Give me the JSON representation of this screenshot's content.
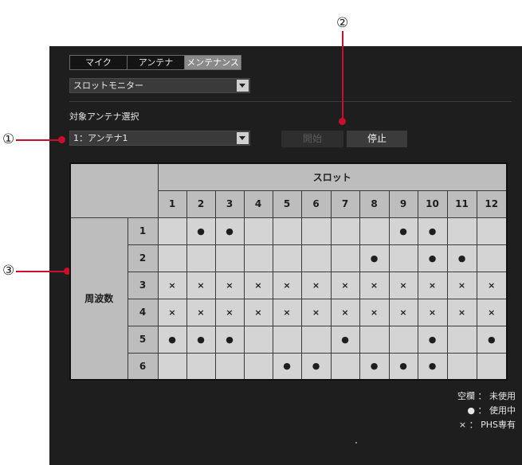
{
  "tabs": [
    {
      "label": "マイク",
      "active": false
    },
    {
      "label": "アンテナ",
      "active": false
    },
    {
      "label": "メンテナンス",
      "active": true
    }
  ],
  "mode_select": {
    "value": "スロットモニター"
  },
  "antenna_section": {
    "label": "対象アンテナ選択"
  },
  "antenna_select": {
    "value": "1：アンテナ1"
  },
  "buttons": {
    "start": "開始",
    "stop": "停止"
  },
  "callouts": {
    "c1": "①",
    "c2": "②",
    "c3": "③"
  },
  "table": {
    "slot_header": "スロット",
    "freq_header": "周波数",
    "slots": [
      "1",
      "2",
      "3",
      "4",
      "5",
      "6",
      "7",
      "8",
      "9",
      "10",
      "11",
      "12"
    ],
    "rows": [
      {
        "freq": "1",
        "cells": [
          "",
          "●",
          "●",
          "",
          "",
          "",
          "",
          "",
          "●",
          "●",
          "",
          ""
        ]
      },
      {
        "freq": "2",
        "cells": [
          "",
          "",
          "",
          "",
          "",
          "",
          "",
          "●",
          "",
          "●",
          "●",
          ""
        ]
      },
      {
        "freq": "3",
        "cells": [
          "×",
          "×",
          "×",
          "×",
          "×",
          "×",
          "×",
          "×",
          "×",
          "×",
          "×",
          "×"
        ]
      },
      {
        "freq": "4",
        "cells": [
          "×",
          "×",
          "×",
          "×",
          "×",
          "×",
          "×",
          "×",
          "×",
          "×",
          "×",
          "×"
        ]
      },
      {
        "freq": "5",
        "cells": [
          "●",
          "●",
          "●",
          "",
          "",
          "",
          "●",
          "",
          "",
          "●",
          "",
          "●"
        ]
      },
      {
        "freq": "6",
        "cells": [
          "",
          "",
          "",
          "",
          "●",
          "●",
          "",
          "●",
          "●",
          "●",
          "",
          ""
        ]
      }
    ]
  },
  "legend": {
    "empty": "空欄 ： 未使用",
    "used": "● ： 使用中",
    "phs": "× ： PHS専有"
  },
  "colors": {
    "panel": "#1e1e1e",
    "callout_red": "#c8102e",
    "header_gray": "#bdbdbd",
    "cell_gray": "#d4d4d4"
  }
}
